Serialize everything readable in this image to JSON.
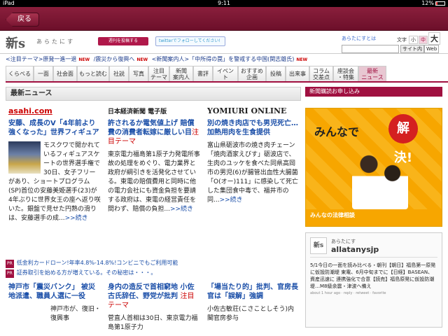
{
  "status": {
    "device": "iPad",
    "time": "9:11",
    "battery": "12%"
  },
  "nav": {
    "back": "戻る"
  },
  "header": {
    "logo": "新s",
    "logo_sub": "あらたにす",
    "mail_btn": "週刊を投稿する",
    "twitter_btn": "twitterでフォローしてください!",
    "about": "あらたにすとは",
    "size_label": "文字",
    "size_small": "小",
    "size_mid": "中",
    "size_big": "大",
    "site_search": "サイト内",
    "web": "Web"
  },
  "ticker": {
    "items": [
      "<注目テーマ>原発一進一退",
      "/震災から復興へ",
      "<新聞案内人>「中所得の罠」を警戒する中国(関志雄氏)"
    ],
    "new": "NEW"
  },
  "tabs": [
    "くらべる",
    "一面",
    "社会面",
    "もっと読む",
    "社説",
    "写真",
    "注目\nテーマ",
    "新聞\n案内人",
    "書評",
    "イベント",
    "おすすめ\n企画",
    "投稿",
    "出来事",
    "コラム\n交差点",
    "座談会\n・特集",
    "最新\nニュース"
  ],
  "main": {
    "heading": "最新ニュース",
    "cols": [
      {
        "source": "asahi.com",
        "title": "安藤、成長のV「4年前より強くなった」世界フィギュア",
        "body": "モスクワで開かれているフィギュアスケートの世界選手権で30日、女子フリーがあり、ショートプログラム(SP)首位の安藤美姫選手(23)が4年ぶりに世界女王の座へ返り咲いた。銀盤で見せた円熟の滑りは、安藤選手の成...",
        "more": ">>続き"
      },
      {
        "source": "日本経済新聞 電子版",
        "title": "許されるか電気値上げ 賠償費の消費者転嫁に厳しい目",
        "tag": "注目テーマ",
        "body": "東京電力福島第1原子力発電所事故の処理をめぐり、電力業界と政府が綱引きを活発化させている。東電の賠償費用と同時に他の電力会社にも資金負担を要請する政府は、東電の経営責任を問わず、賠償の負担...",
        "more": ">>続き"
      },
      {
        "source": "YOMIURI ONLINE",
        "title": "別の焼き肉店でも男児死亡…加熱用肉を生食提供",
        "body": "富山県砺波市の焼き肉チェーン「焼肉酒家えびす」砺波店で、生肉のユッケを食べた同県高岡市の男児(6)が腸管出血性大腸菌「O(オー)111」に感染して死亡した集団食中毒で、福井市の同...",
        "more": ">>続き"
      }
    ],
    "pr": [
      "低金利カードローン!年率4.8%-14.8%!コンビニでもご利用可能",
      "証券取引を始める方が増えている。その秘密は・・・。"
    ],
    "lower": [
      {
        "title": "神戸市「震災バンク」 被災地派遣、職員人選に一役",
        "body": "神戸市が、復旧・復興事"
      },
      {
        "title": "身内の造反で首相窮地 小佐古氏辞任、野党が批判",
        "tag": "注目テーマ",
        "body": "菅直人首相は30日、東京電力福島第1原子力"
      },
      {
        "title": "「場当たり的」批判、官房長官は「誤解」強調",
        "body": "小佐古敏荘(こさことしそう)内閣官房参与"
      }
    ]
  },
  "side": {
    "subscribe": "新聞購読お申し込み",
    "ad_text": "みんなで",
    "ad_kai": "解決!",
    "ad_bar": "みんなの法律相談",
    "tw": {
      "logo": "新s",
      "name": "あらたにす",
      "handle": "allatanysjp",
      "text": "5/1今日の一面を読み比べる・朝刊【朝日】福島第一原発に仮設防潮堤 東電、6月中旬までに【日経】BASEAN、資産迅速に 連携強化で合意【読売】福島原発に仮設防潮堤…M8級余震・津波へ備え",
      "meta": "about 1 hour ago · reply · retweet · favorite"
    }
  }
}
